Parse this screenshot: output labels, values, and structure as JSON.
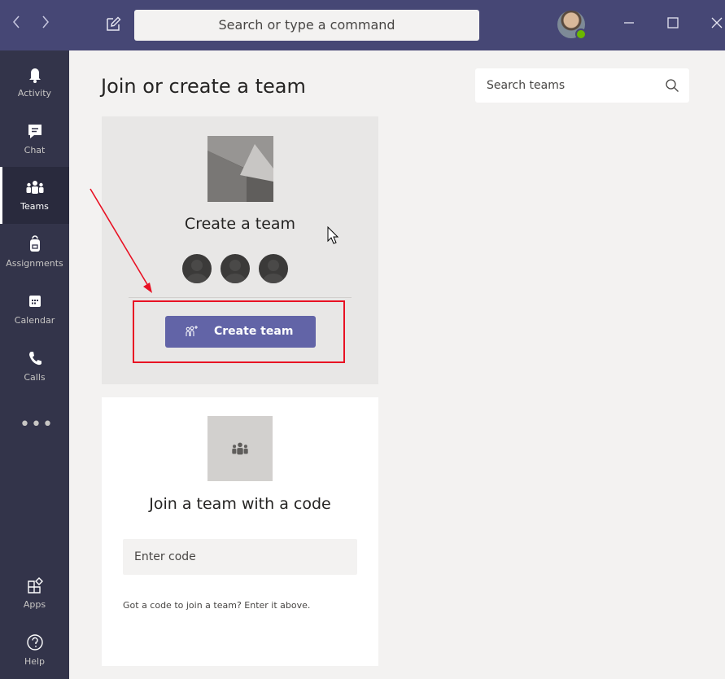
{
  "titlebar": {
    "back_icon": "chevron-left-icon",
    "forward_icon": "chevron-right-icon",
    "compose_icon": "compose-icon",
    "search_placeholder": "Search or type a command",
    "status_color": "#6bb700"
  },
  "rail": {
    "items": [
      {
        "label": "Activity",
        "icon": "bell-icon"
      },
      {
        "label": "Chat",
        "icon": "chat-icon"
      },
      {
        "label": "Teams",
        "icon": "teams-icon",
        "active": true
      },
      {
        "label": "Assignments",
        "icon": "backpack-icon"
      },
      {
        "label": "Calendar",
        "icon": "calendar-icon"
      },
      {
        "label": "Calls",
        "icon": "phone-icon"
      }
    ],
    "more": "•••",
    "bottom_items": [
      {
        "label": "Apps",
        "icon": "apps-icon"
      },
      {
        "label": "Help",
        "icon": "help-icon"
      }
    ]
  },
  "main": {
    "title": "Join or create a team",
    "search_placeholder": "Search teams",
    "create_card": {
      "heading": "Create a team",
      "button_label": "Create team"
    },
    "join_card": {
      "heading": "Join a team with a code",
      "input_placeholder": "Enter code",
      "hint": "Got a code to join a team? Enter it above."
    }
  },
  "colors": {
    "titlebar": "#464775",
    "rail": "#33344a",
    "accent": "#6264a7",
    "highlight": "#e81123"
  }
}
